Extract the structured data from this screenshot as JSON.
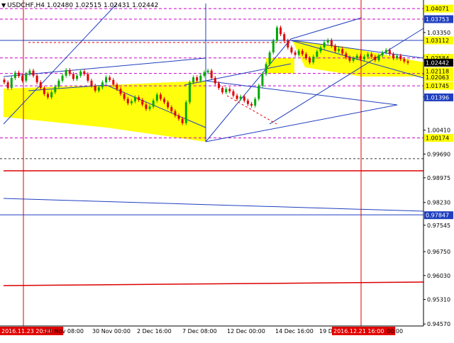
{
  "header": {
    "symbol": "USDCHF,H4",
    "ohlc": "1.02480 1.02515 1.02431 1.02442"
  },
  "colors": {
    "background": "#ffffff",
    "bull_candle": "#00aa00",
    "bear_candle": "#e00000",
    "highlight_band": "#ffff00",
    "magenta_level": "#cc00cc",
    "blue_trend": "#1f3fbf",
    "red_level": "#dd0000",
    "price_label_bg": "#ffff00",
    "current_label_bg": "#000000",
    "navy_label_bg": "#1f3fbf"
  },
  "chart_data": {
    "type": "candlestick",
    "title": "USDCHF,H4",
    "ylim": [
      0.9451,
      1.0433
    ],
    "y_ticks": [
      "1.03350",
      "1.02640",
      "1.02095",
      "1.01410",
      "1.00410",
      "0.99690",
      "0.98975",
      "0.98230",
      "0.97545",
      "0.96750",
      "0.96030",
      "0.95310",
      "0.94570"
    ],
    "x_tick_labels": [
      "2016.11.23 20:00",
      "25 Nov 08:00",
      "30 Nov 00:00",
      "2 Dec 16:00",
      "7 Dec 08:00",
      "12 Dec 00:00",
      "14 Dec 16:00",
      "19 Dec",
      "2016.12.21 16:00",
      "00:00"
    ],
    "x_marker_labels": [
      "2016.11.23 20:00",
      "2016.12.21 16:00"
    ],
    "price_labels": [
      {
        "value": "1.04071",
        "style": "yellow"
      },
      {
        "value": "1.03753",
        "style": "navy"
      },
      {
        "value": "1.03112",
        "style": "yellow"
      },
      {
        "value": "1.02584",
        "style": "yellow"
      },
      {
        "value": "1.02442",
        "style": "current"
      },
      {
        "value": "1.02118",
        "style": "yellow"
      },
      {
        "value": "1.02063",
        "style": "yellow"
      },
      {
        "value": "1.01745",
        "style": "yellow"
      },
      {
        "value": "1.01396",
        "style": "navy"
      },
      {
        "value": "1.00174",
        "style": "yellow"
      },
      {
        "value": "0.97847",
        "style": "navy"
      }
    ],
    "horizontal_levels": [
      {
        "value": 1.04071,
        "style": "magenta-dashed"
      },
      {
        "value": 1.03753,
        "style": "magenta-dashed"
      },
      {
        "value": 1.03112,
        "style": "blue-solid"
      },
      {
        "value": 1.02584,
        "style": "magenta-dashed"
      },
      {
        "value": 1.02118,
        "style": "magenta-dashed"
      },
      {
        "value": 1.01745,
        "style": "magenta-dashed"
      },
      {
        "value": 1.00174,
        "style": "magenta-dashed"
      },
      {
        "value": 0.9955,
        "style": "black-dashed"
      },
      {
        "value": 0.9786,
        "style": "blue-solid"
      }
    ],
    "candle_closes": [
      1.0185,
      1.0168,
      1.0198,
      1.0214,
      1.0204,
      1.019,
      1.021,
      1.022,
      1.0205,
      1.0185,
      1.0168,
      1.015,
      1.014,
      1.0155,
      1.0172,
      1.019,
      1.0205,
      1.0222,
      1.021,
      1.0195,
      1.0205,
      1.0218,
      1.021,
      1.019,
      1.0175,
      1.016,
      1.017,
      1.0185,
      1.02,
      1.0192,
      1.0178,
      1.0165,
      1.015,
      1.0135,
      1.0122,
      1.0128,
      1.014,
      1.0132,
      1.0118,
      1.0105,
      1.0112,
      1.013,
      1.0148,
      1.0135,
      1.0125,
      1.011,
      1.0098,
      1.0085,
      1.0075,
      1.0062,
      1.0125,
      1.0185,
      1.02,
      1.019,
      1.0205,
      1.0215,
      1.022,
      1.0198,
      1.0182,
      1.0168,
      1.0155,
      1.0165,
      1.0158,
      1.0145,
      1.0135,
      1.0142,
      1.013,
      1.012,
      1.0115,
      1.0135,
      1.0175,
      1.021,
      1.024,
      1.0275,
      1.031,
      1.035,
      1.033,
      1.031,
      1.029,
      1.0275,
      1.0268,
      1.028,
      1.027,
      1.0258,
      1.0245,
      1.0262,
      1.0278,
      1.029,
      1.0305,
      1.0312,
      1.0295,
      1.028,
      1.0285,
      1.0272,
      1.026,
      1.025,
      1.0258,
      1.0265,
      1.0255,
      1.0262,
      1.027,
      1.0262,
      1.0252,
      1.0266,
      1.0275,
      1.0282,
      1.027,
      1.0258,
      1.0265,
      1.0255,
      1.0248,
      1.0244
    ]
  }
}
